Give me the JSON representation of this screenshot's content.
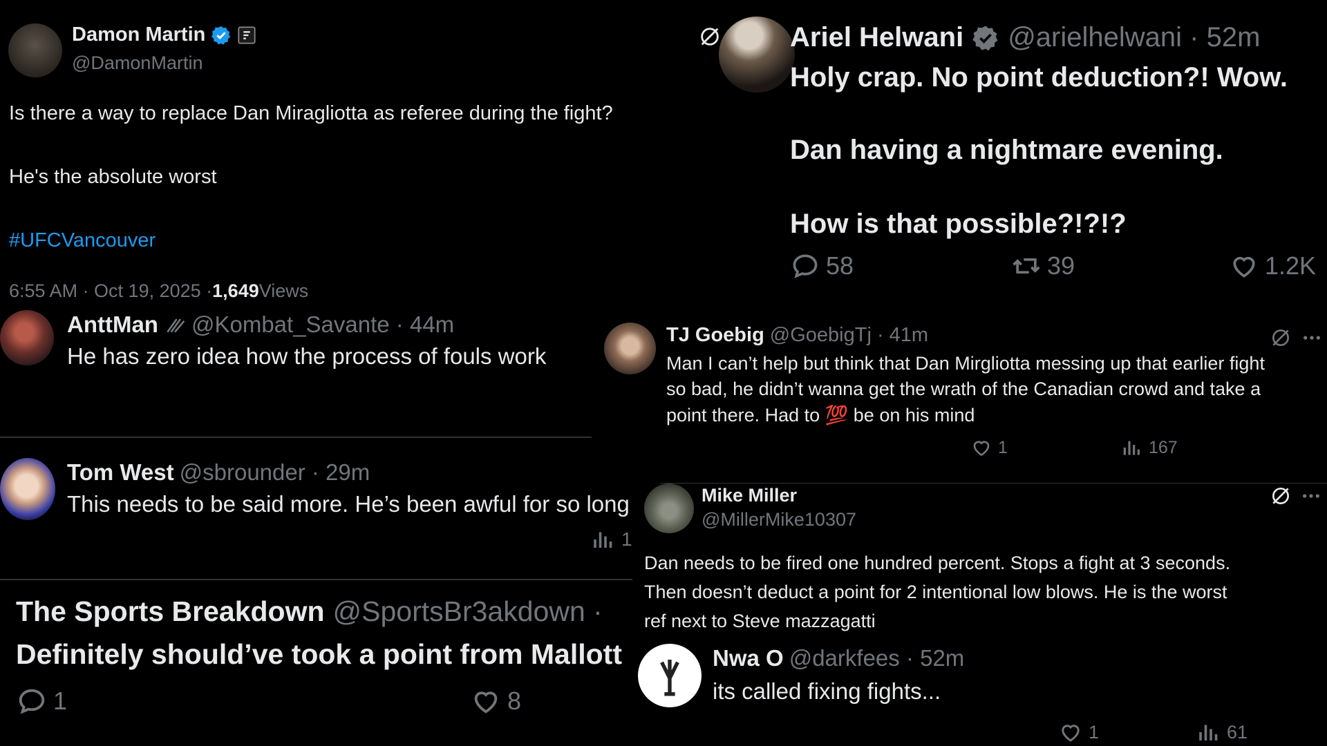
{
  "colors": {
    "background": "#000000",
    "text": "#e7e9ea",
    "muted": "#71767b",
    "link": "#1d9bf0",
    "verified": "#1d9bf0",
    "divider": "#2f3336"
  },
  "t1": {
    "name": "Damon Martin",
    "handle": "@DamonMartin",
    "line1": "Is there a way to replace Dan Miragliotta as referee during the fight?",
    "line2": "He's the absolute worst",
    "hashtag": "#UFCVancouver",
    "meta": "6:55 AM · Oct 19, 2025 · ",
    "views_count": "1,649",
    "views_label": " Views"
  },
  "t2": {
    "name": "Ariel Helwani",
    "handle": "@arielhelwani · 52m",
    "line1": "Holy crap. No point deduction?! Wow.",
    "line2": "Dan having a nightmare evening.",
    "line3": "How is that possible?!?!?",
    "replies": "58",
    "retweets": "39",
    "likes": "1.2K"
  },
  "t3": {
    "name": "AnttMan",
    "handle": "@Kombat_Savante · 44m",
    "text": "He has zero idea how the process of fouls work"
  },
  "t4": {
    "name": "TJ Goebig",
    "handle": "@GoebigTj · 41m",
    "line1": "Man I can’t help but think that Dan Mirgliotta messing up that earlier fight",
    "line2": "so bad, he didn’t wanna get the wrath of the Canadian crowd and take a",
    "line3a": "point there.  Had to ",
    "emoji": "💯",
    "line3b": " be on his mind",
    "likes": "1",
    "views": "167"
  },
  "t5": {
    "name": "Tom West",
    "handle": "@sbrounder · 29m",
    "text": "This needs to be said more. He’s been awful for so long",
    "views": "1"
  },
  "t6": {
    "name": "Mike Miller",
    "handle": "@MillerMike10307",
    "line1": "Dan needs to be fired one hundred percent.  Stops a fight at 3 seconds.",
    "line2": "Then doesn’t deduct a point for 2 intentional low blows.   He is the worst",
    "line3": "ref next to Steve mazzagatti"
  },
  "t7": {
    "name": "The Sports Breakdown",
    "handle": "@SportsBr3akdown ·",
    "text": "Definitely should’ve took a point from Mallott",
    "replies": "1",
    "likes": "8"
  },
  "t8": {
    "name": "Nwa O",
    "handle": "@darkfees · 52m",
    "text": "its called fixing fights...",
    "likes": "1",
    "views": "61"
  }
}
